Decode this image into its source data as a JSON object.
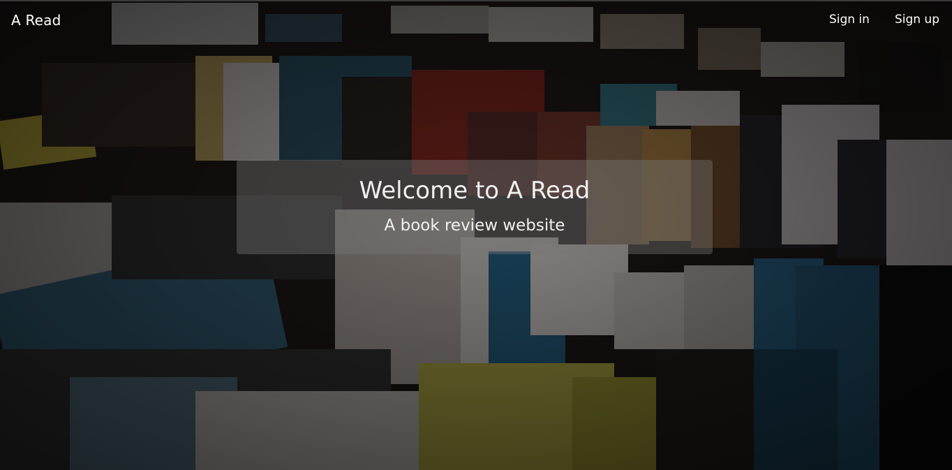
{
  "navbar": {
    "brand": "A Read",
    "links": [
      {
        "label": "Sign in"
      },
      {
        "label": "Sign up"
      }
    ]
  },
  "hero": {
    "title": "Welcome to A Read",
    "subtitle": "A book review website",
    "background": "books-photo"
  },
  "colors": {
    "overlay": "#787878",
    "text": "#ffffff"
  }
}
